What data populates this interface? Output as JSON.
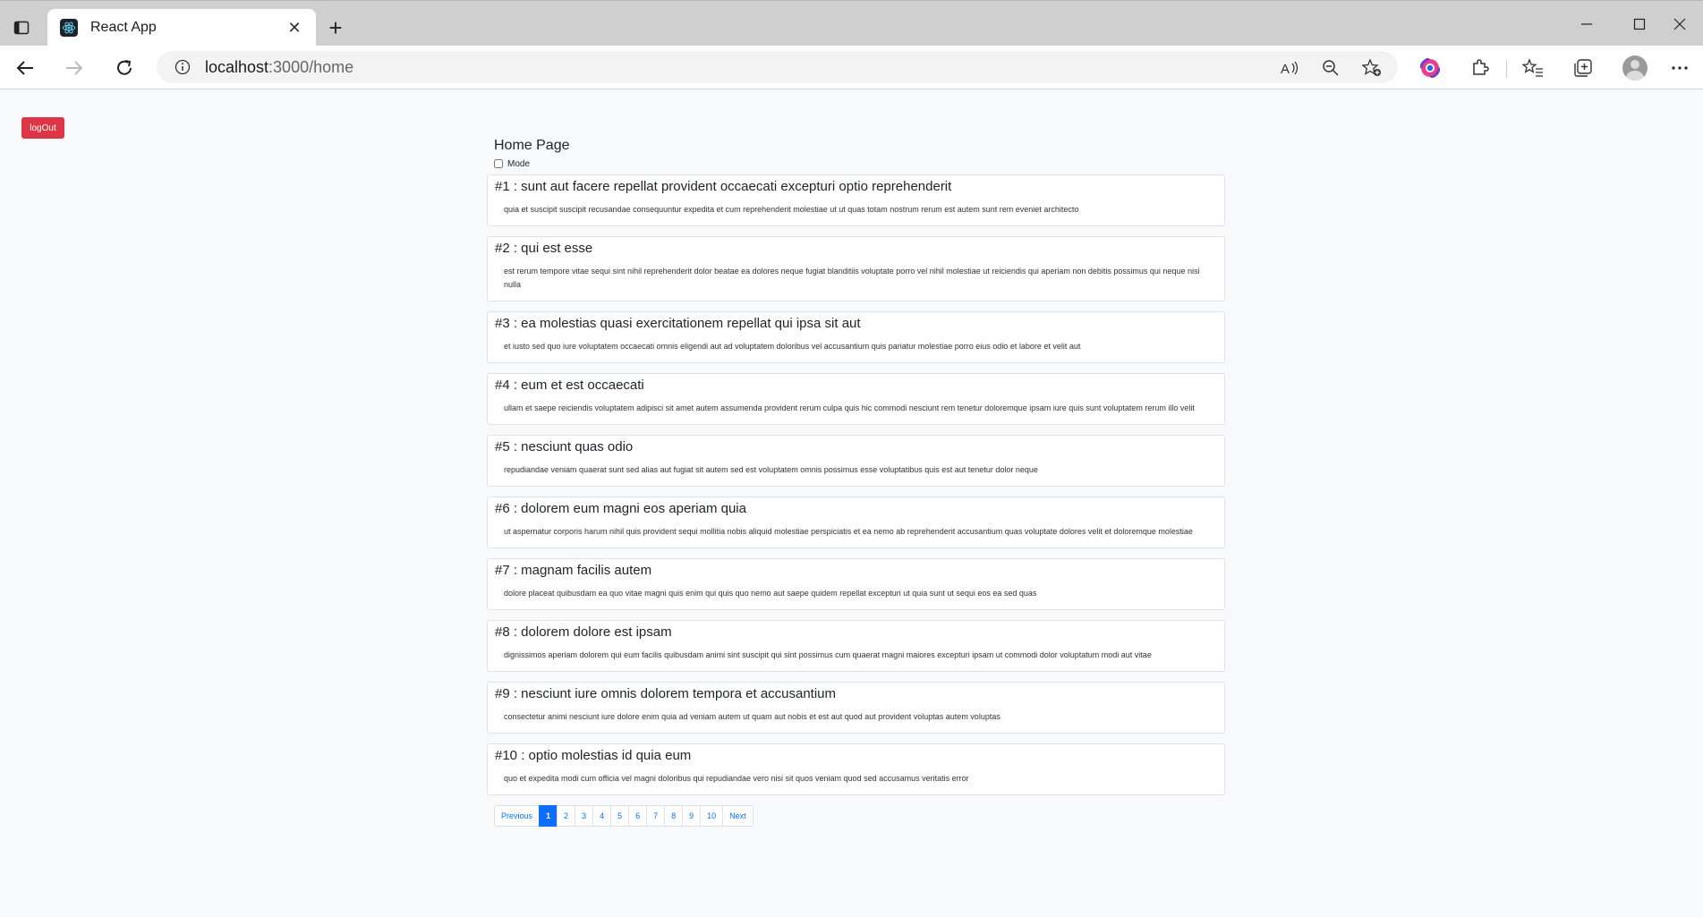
{
  "browser": {
    "tab_title": "React App",
    "tab_close": "✕",
    "new_tab": "+",
    "url_host": "localhost",
    "url_path": ":3000/home",
    "colors": {
      "tabstrip": "#cfcfcf",
      "toolbar": "#ffffff"
    }
  },
  "page": {
    "logout_label": "logOut",
    "title": "Home Page",
    "mode_label": "Mode",
    "colors": {
      "logout": "#dc3545",
      "active_page": "#0d6efd"
    }
  },
  "posts": [
    {
      "title": "#1 : sunt aut facere repellat provident occaecati excepturi optio reprehenderit",
      "body": "quia et suscipit suscipit recusandae consequuntur expedita et cum reprehenderit molestiae ut ut quas totam nostrum rerum est autem sunt rem eveniet architecto"
    },
    {
      "title": "#2 : qui est esse",
      "body": "est rerum tempore vitae sequi sint nihil reprehenderit dolor beatae ea dolores neque fugiat blanditiis voluptate porro vel nihil molestiae ut reiciendis qui aperiam non debitis possimus qui neque nisi nulla"
    },
    {
      "title": "#3 : ea molestias quasi exercitationem repellat qui ipsa sit aut",
      "body": "et iusto sed quo iure voluptatem occaecati omnis eligendi aut ad voluptatem doloribus vel accusantium quis pariatur molestiae porro eius odio et labore et velit aut"
    },
    {
      "title": "#4 : eum et est occaecati",
      "body": "ullam et saepe reiciendis voluptatem adipisci sit amet autem assumenda provident rerum culpa quis hic commodi nesciunt rem tenetur doloremque ipsam iure quis sunt voluptatem rerum illo velit"
    },
    {
      "title": "#5 : nesciunt quas odio",
      "body": "repudiandae veniam quaerat sunt sed alias aut fugiat sit autem sed est voluptatem omnis possimus esse voluptatibus quis est aut tenetur dolor neque"
    },
    {
      "title": "#6 : dolorem eum magni eos aperiam quia",
      "body": "ut aspernatur corporis harum nihil quis provident sequi mollitia nobis aliquid molestiae perspiciatis et ea nemo ab reprehenderit accusantium quas voluptate dolores velit et doloremque molestiae"
    },
    {
      "title": "#7 : magnam facilis autem",
      "body": "dolore placeat quibusdam ea quo vitae magni quis enim qui quis quo nemo aut saepe quidem repellat excepturi ut quia sunt ut sequi eos ea sed quas"
    },
    {
      "title": "#8 : dolorem dolore est ipsam",
      "body": "dignissimos aperiam dolorem qui eum facilis quibusdam animi sint suscipit qui sint possimus cum quaerat magni maiores excepturi ipsam ut commodi dolor voluptatum modi aut vitae"
    },
    {
      "title": "#9 : nesciunt iure omnis dolorem tempora et accusantium",
      "body": "consectetur animi nesciunt iure dolore enim quia ad veniam autem ut quam aut nobis et est aut quod aut provident voluptas autem voluptas"
    },
    {
      "title": "#10 : optio molestias id quia eum",
      "body": "quo et expedita modi cum officia vel magni doloribus qui repudiandae vero nisi sit quos veniam quod sed accusamus veritatis error"
    }
  ],
  "pagination": {
    "items": [
      "Previous",
      "1",
      "2",
      "3",
      "4",
      "5",
      "6",
      "7",
      "8",
      "9",
      "10",
      "Next"
    ],
    "active": "1"
  }
}
